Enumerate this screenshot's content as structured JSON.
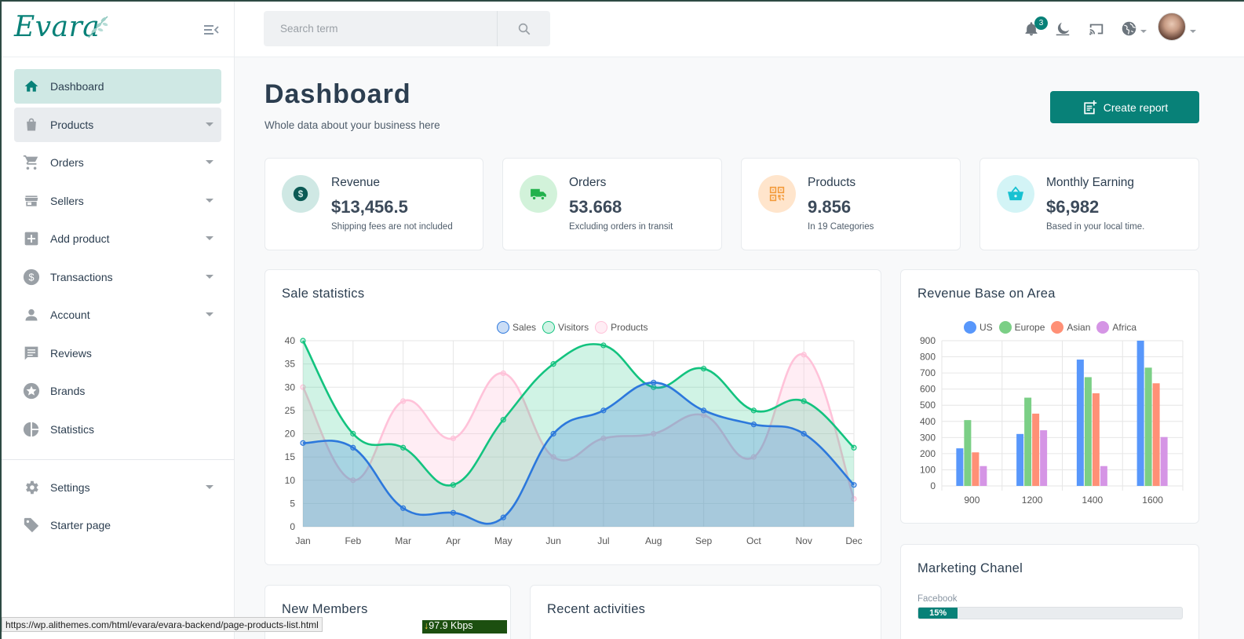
{
  "brand": {
    "logo_text": "Evara"
  },
  "sidebar": {
    "items": [
      {
        "label": "Dashboard",
        "icon": "home-icon"
      },
      {
        "label": "Products",
        "icon": "shopping-bag-icon"
      },
      {
        "label": "Orders",
        "icon": "cart-icon"
      },
      {
        "label": "Sellers",
        "icon": "store-icon"
      },
      {
        "label": "Add product",
        "icon": "plus-box-icon"
      },
      {
        "label": "Transactions",
        "icon": "dollar-circle-icon"
      },
      {
        "label": "Account",
        "icon": "person-icon"
      },
      {
        "label": "Reviews",
        "icon": "comment-icon"
      },
      {
        "label": "Brands",
        "icon": "star-circle-icon"
      },
      {
        "label": "Statistics",
        "icon": "pie-chart-icon"
      }
    ],
    "bottom_items": [
      {
        "label": "Settings",
        "icon": "gear-icon"
      },
      {
        "label": "Starter page",
        "icon": "tag-icon"
      }
    ]
  },
  "header": {
    "search_placeholder": "Search term",
    "notification_count": "3"
  },
  "page": {
    "title": "Dashboard",
    "subtitle": "Whole data about your business here",
    "create_button": "Create report"
  },
  "stats": [
    {
      "title": "Revenue",
      "value": "$13,456.5",
      "note": "Shipping fees are not included",
      "color": "#cfe8e4",
      "icon_color": "#088178"
    },
    {
      "title": "Orders",
      "value": "53.668",
      "note": "Excluding orders in transit",
      "color": "#d2f2da",
      "icon_color": "#22b14c"
    },
    {
      "title": "Products",
      "value": "9.856",
      "note": "In 19 Categories",
      "color": "#ffe5cc",
      "icon_color": "#f39c3d"
    },
    {
      "title": "Monthly Earning",
      "value": "$6,982",
      "note": "Based in your local time.",
      "color": "#d3f4f6",
      "icon_color": "#17c1d1"
    }
  ],
  "sale_stats": {
    "title": "Sale statistics"
  },
  "revenue_area": {
    "title": "Revenue Base on Area"
  },
  "marketing": {
    "title": "Marketing Chanel",
    "channels": [
      {
        "name": "Facebook",
        "percent_label": "15%",
        "percent": 15
      }
    ]
  },
  "new_members": {
    "title": "New Members"
  },
  "recent": {
    "title": "Recent activities"
  },
  "status_bar": {
    "url": "https://wp.alithemes.com/html/evara/evara-backend/page-products-list.html",
    "speed": "97.9 Kbps"
  },
  "chart_data": [
    {
      "type": "area",
      "categories": [
        "Jan",
        "Feb",
        "Mar",
        "Apr",
        "May",
        "Jun",
        "Jul",
        "Aug",
        "Sep",
        "Oct",
        "Nov",
        "Dec"
      ],
      "ylim": [
        0,
        40
      ],
      "yticks": [
        0,
        5,
        10,
        15,
        20,
        25,
        30,
        35,
        40
      ],
      "series": [
        {
          "name": "Sales",
          "values": [
            18,
            17,
            4,
            3,
            2,
            20,
            25,
            31,
            25,
            22,
            20,
            9
          ],
          "color": "#2c78dc",
          "fill": "rgba(44,120,220,0.25)"
        },
        {
          "name": "Visitors",
          "values": [
            40,
            20,
            17,
            9,
            23,
            35,
            39,
            30,
            34,
            25,
            27,
            17
          ],
          "color": "#13c37f",
          "fill": "rgba(19,195,127,0.2)"
        },
        {
          "name": "Products",
          "values": [
            30,
            10,
            27,
            19,
            33,
            15,
            19,
            20,
            24,
            15,
            37,
            6
          ],
          "color": "#ffc2d9",
          "fill": "rgba(255,194,217,0.3)"
        }
      ]
    },
    {
      "type": "bar",
      "categories": [
        "900",
        "1200",
        "1400",
        "1600"
      ],
      "ylim": [
        0,
        900
      ],
      "yticks": [
        0,
        100,
        200,
        300,
        400,
        500,
        600,
        700,
        800,
        900
      ],
      "series": [
        {
          "name": "US",
          "values": [
            233,
            322,
            783,
            900
          ],
          "color": "#5897fb"
        },
        {
          "name": "Europe",
          "values": [
            408,
            547,
            674,
            733
          ],
          "color": "#7bcf86"
        },
        {
          "name": "Asian",
          "values": [
            208,
            448,
            574,
            636
          ],
          "color": "#ff9076"
        },
        {
          "name": "Africa",
          "values": [
            123,
            345,
            123,
            303
          ],
          "color": "#d595e5"
        }
      ]
    }
  ]
}
